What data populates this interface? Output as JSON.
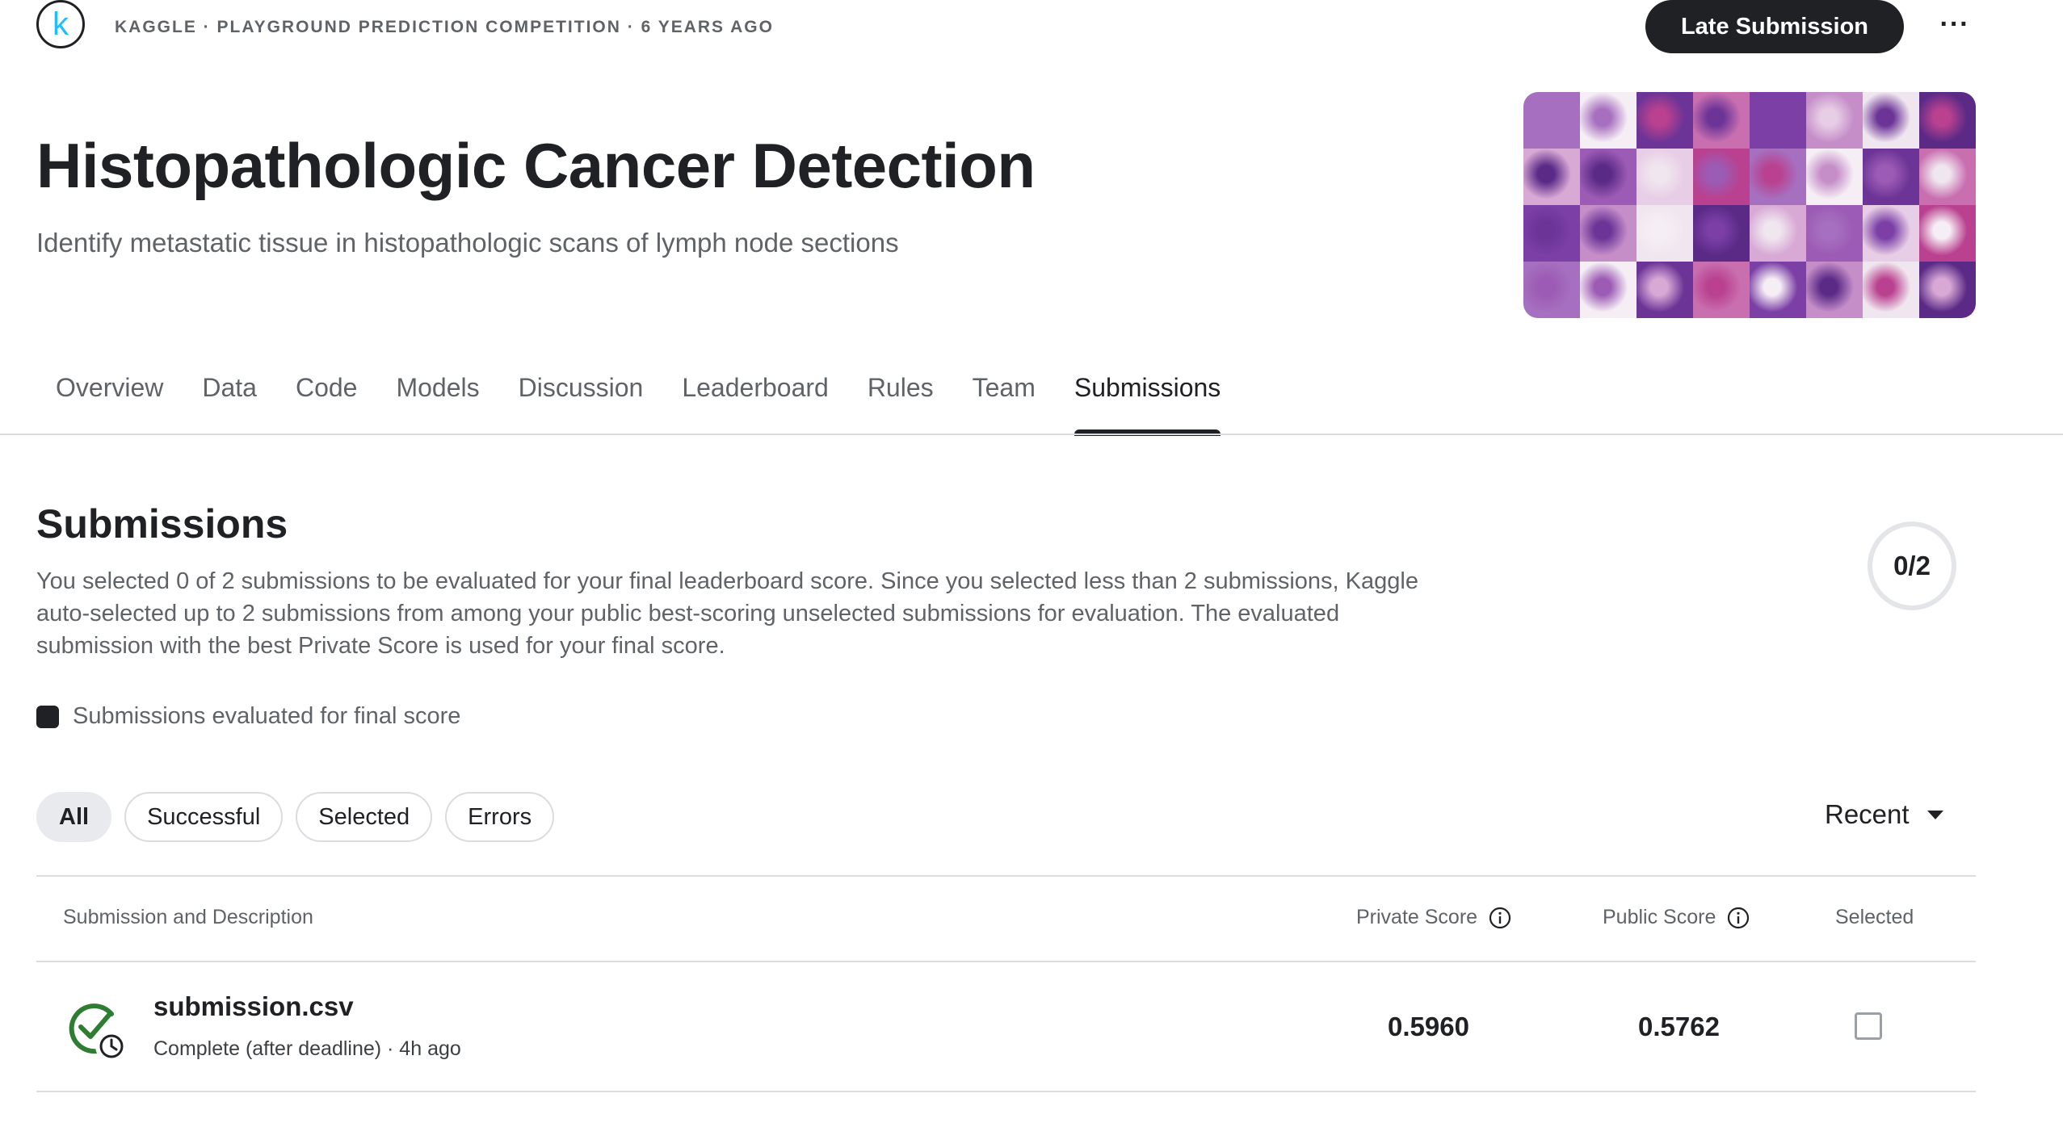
{
  "header": {
    "logo_letter": "k",
    "breadcrumb": "KAGGLE · PLAYGROUND PREDICTION COMPETITION · 6 YEARS AGO",
    "late_submission_label": "Late Submission",
    "more_label": "···"
  },
  "competition": {
    "title": "Histopathologic Cancer Detection",
    "subtitle": "Identify metastatic tissue in histopathologic scans of lymph node sections"
  },
  "tabs": [
    {
      "label": "Overview"
    },
    {
      "label": "Data"
    },
    {
      "label": "Code"
    },
    {
      "label": "Models"
    },
    {
      "label": "Discussion"
    },
    {
      "label": "Leaderboard"
    },
    {
      "label": "Rules"
    },
    {
      "label": "Team"
    },
    {
      "label": "Submissions",
      "active": true
    }
  ],
  "submissions": {
    "title": "Submissions",
    "description": "You selected 0 of 2 submissions to be evaluated for your final leaderboard score. Since you selected less than 2 submissions, Kaggle auto-selected up to 2 submissions from among your public best-scoring unselected submissions for evaluation. The evaluated submission with the best Private Score is used for your final score.",
    "selected_count": "0/2",
    "legend_label": "Submissions evaluated for final score"
  },
  "filters": {
    "chips": [
      "All",
      "Successful",
      "Selected",
      "Errors"
    ],
    "active_chip": "All",
    "sort_label": "Recent"
  },
  "table": {
    "headers": {
      "description": "Submission and Description",
      "private": "Private Score",
      "public": "Public Score",
      "selected": "Selected"
    },
    "rows": [
      {
        "file_name": "submission.csv",
        "status": "Complete (after deadline) · 4h ago",
        "private_score": "0.5960",
        "public_score": "0.5762",
        "selected": false
      }
    ]
  },
  "colors": {
    "accent_dark": "#202124",
    "muted_text": "#5f6368",
    "success_green": "#2e7d32",
    "kaggle_blue": "#20beff"
  },
  "icons": {
    "logo": "kaggle-k-logo-icon",
    "more": "more-horizontal-icon",
    "info": "info-icon",
    "status": "check-circle-clock-icon",
    "sort": "caret-down-icon"
  }
}
